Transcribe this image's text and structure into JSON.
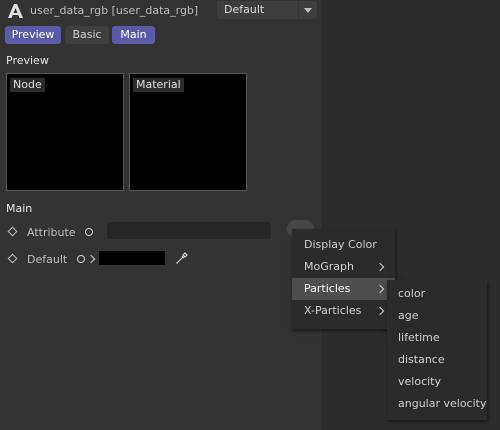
{
  "header": {
    "title": "user_data_rgb [user_data_rgb]",
    "preset": "Default"
  },
  "tabs": [
    {
      "label": "Preview",
      "active": true
    },
    {
      "label": "Basic",
      "active": false
    },
    {
      "label": "Main",
      "active": true
    }
  ],
  "preview": {
    "section_title": "Preview",
    "node_label": "Node",
    "material_label": "Material"
  },
  "main": {
    "section_title": "Main",
    "attribute_label": "Attribute",
    "default_label": "Default",
    "default_color": "#000000"
  },
  "menu": {
    "items": [
      "Display Color",
      "MoGraph",
      "Particles",
      "X-Particles"
    ],
    "highlighted": "Particles"
  },
  "submenu": {
    "items": [
      "color",
      "age",
      "lifetime",
      "distance",
      "velocity",
      "angular velocity"
    ]
  },
  "colors": {
    "accent": "#5a5aa6",
    "panel_bg": "#333333",
    "menu_bg": "#2b2b2b",
    "menu_highlight": "#4e4e4e"
  },
  "icons": {
    "app": "app-logo-icon",
    "preset_dropdown": "chevron-down-icon",
    "keyframe": "keyframe-diamond-icon",
    "animate": "circle-icon",
    "expand": "chevron-right-icon",
    "picker": "eyedropper-icon"
  }
}
